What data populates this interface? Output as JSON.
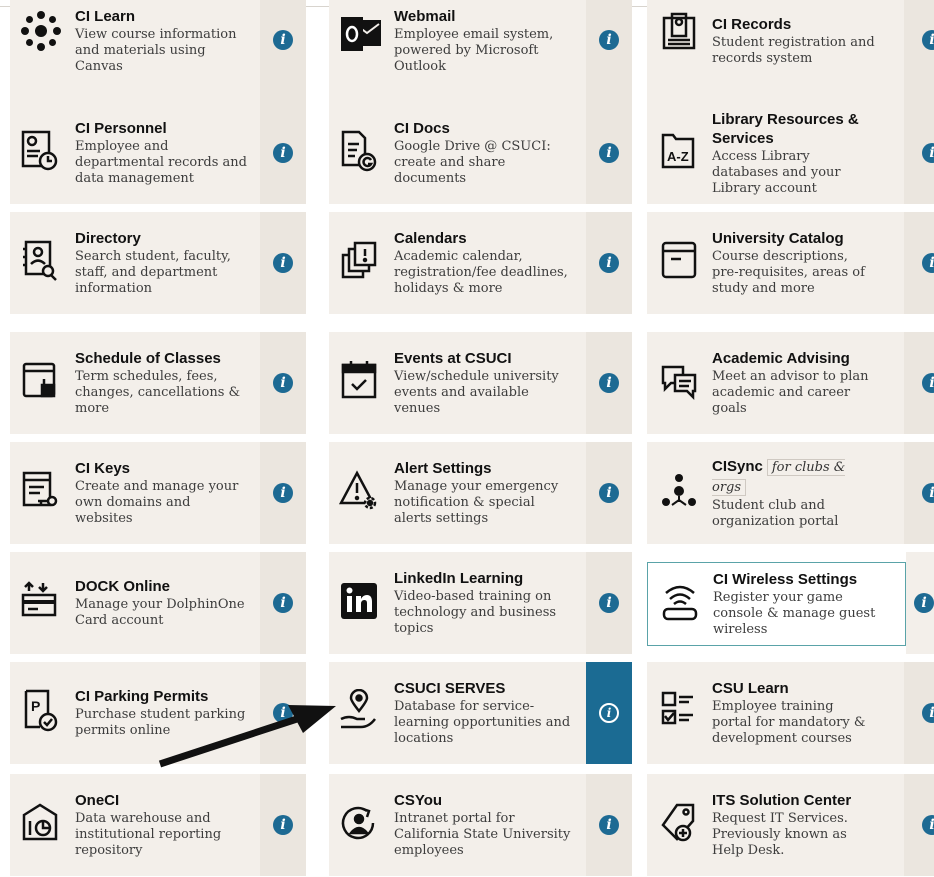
{
  "colors": {
    "tile_bg": "#f3efea",
    "info_bg": "#1d6a93",
    "active_info_col": "#1b6b93",
    "highlight_border": "#5aa3a8"
  },
  "info_glyph": "i",
  "tiles": [
    {
      "title": "CI Learn",
      "desc": "View course information and materials using Canvas",
      "icon": "ci-learn-icon"
    },
    {
      "title": "Webmail",
      "desc": "Employee email system, powered by Microsoft Outlook",
      "icon": "outlook-icon"
    },
    {
      "title": "CI Records",
      "desc": "Student registration and records system",
      "icon": "records-icon"
    },
    {
      "title": "CI Personnel",
      "desc": "Employee and departmental records and data management",
      "icon": "personnel-icon"
    },
    {
      "title": "CI Docs",
      "desc": "Google Drive @ CSUCI: create and share documents",
      "icon": "docs-icon"
    },
    {
      "title": "Library Resources & Services",
      "desc": "Access Library databases and your Library account",
      "icon": "library-icon"
    },
    {
      "title": "Directory",
      "desc": "Search student, faculty, staff, and department information",
      "icon": "directory-icon"
    },
    {
      "title": "Calendars",
      "desc": "Academic calendar, registration/fee deadlines, holidays & more",
      "icon": "calendars-icon"
    },
    {
      "title": "University Catalog",
      "desc": "Course descriptions, pre-requisites, areas of study and more",
      "icon": "catalog-icon"
    },
    {
      "title": "Schedule of Classes",
      "desc": "Term schedules, fees, changes, cancellations & more",
      "icon": "schedule-icon"
    },
    {
      "title": "Events at CSUCI",
      "desc": "View/schedule university events and available venues",
      "icon": "events-icon"
    },
    {
      "title": "Academic Advising",
      "desc": "Meet an advisor to plan academic and career goals",
      "icon": "advising-icon"
    },
    {
      "title": "CI Keys",
      "desc": "Create and manage your own domains and websites",
      "icon": "keys-icon"
    },
    {
      "title": "Alert Settings",
      "desc": "Manage your emergency notification & special alerts settings",
      "icon": "alert-icon"
    },
    {
      "title": "CISync",
      "tag": "for clubs & orgs",
      "desc": "Student club and organization portal",
      "icon": "cisync-icon"
    },
    {
      "title": "DOCK Online",
      "desc": "Manage your DolphinOne Card account",
      "icon": "dock-icon"
    },
    {
      "title": "LinkedIn Learning",
      "desc": "Video-based training on technology and business topics",
      "icon": "linkedin-icon"
    },
    {
      "title": "CI Wireless Settings",
      "desc": "Register your game console & manage guest wireless",
      "icon": "wireless-icon"
    },
    {
      "title": "CI Parking Permits",
      "desc": "Purchase student parking permits online",
      "icon": "parking-icon"
    },
    {
      "title": "CSUCI SERVES",
      "desc": "Database for service-learning opportunities and locations",
      "icon": "serves-icon"
    },
    {
      "title": "CSU Learn",
      "desc": "Employee training portal for mandatory & development courses",
      "icon": "csu-learn-icon"
    },
    {
      "title": "OneCI",
      "desc": "Data warehouse and institutional reporting repository",
      "icon": "oneci-icon"
    },
    {
      "title": "CSYou",
      "desc": "Intranet portal for California State University employees",
      "icon": "csyou-icon"
    },
    {
      "title": "ITS Solution Center",
      "desc": "Request IT Services. Previously known as Help Desk.",
      "icon": "its-icon"
    }
  ]
}
